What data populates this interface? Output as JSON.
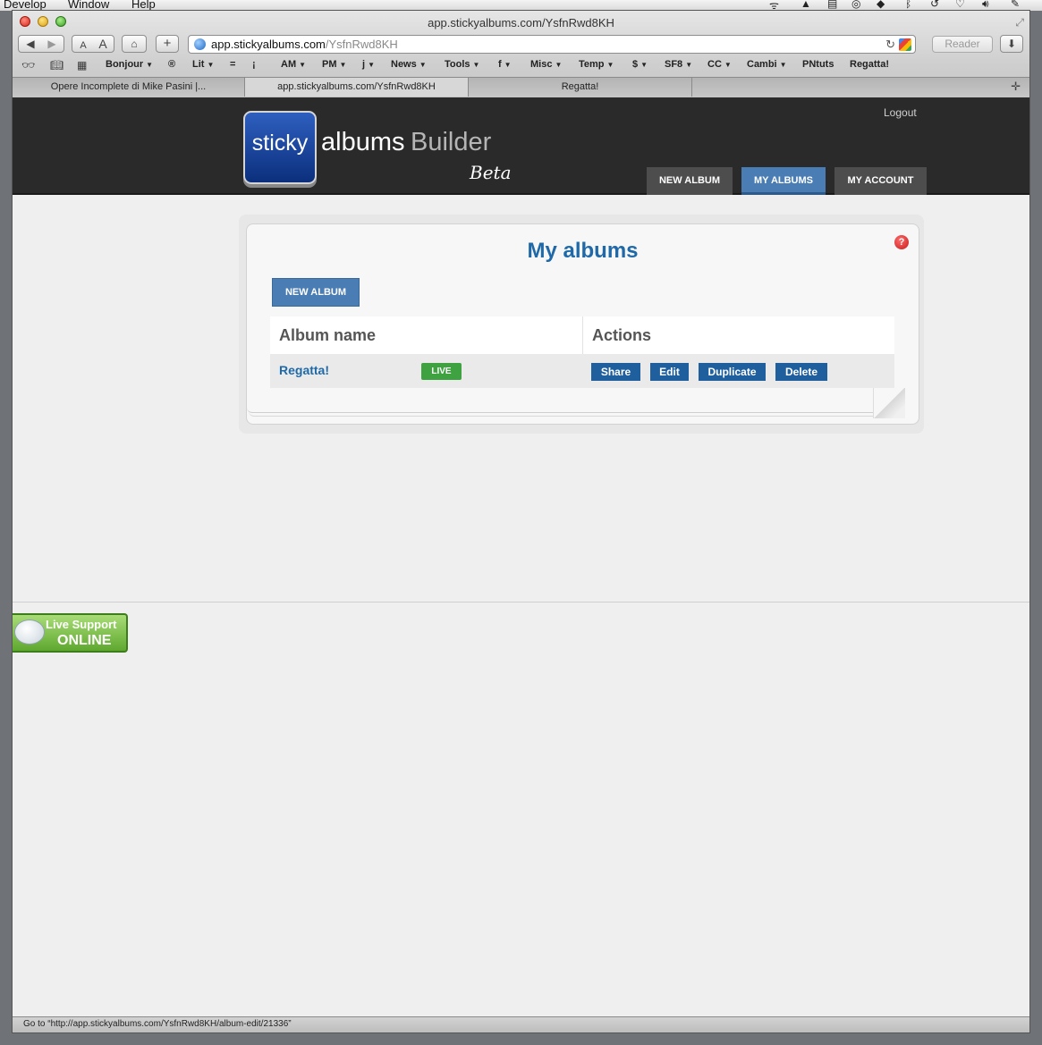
{
  "menubar": {
    "items": [
      "Develop",
      "Window",
      "Help"
    ]
  },
  "window": {
    "title": "app.stickyalbums.com/YsfnRwd8KH"
  },
  "toolbar": {
    "url_host": "app.stickyalbums.com",
    "url_path": "/YsfnRwd8KH",
    "reader_label": "Reader",
    "font_small": "A",
    "font_large": "A",
    "add_label": "+"
  },
  "bookmarks": [
    "Bonjour",
    "Lit",
    "AM",
    "PM",
    "j",
    "News",
    "Tools",
    "f",
    "Misc",
    "Temp",
    "$",
    "SF8",
    "CC",
    "Cambi",
    "PNtuts",
    "Regatta!"
  ],
  "tabs": [
    {
      "label": "Opere Incomplete di Mike Pasini |..."
    },
    {
      "label": "app.stickyalbums.com/YsfnRwd8KH"
    },
    {
      "label": "Regatta!"
    }
  ],
  "header": {
    "logo_sticky": "sticky",
    "logo_albums": "albums",
    "logo_builder": "Builder",
    "logo_beta": "Beta",
    "logout": "Logout",
    "nav": [
      {
        "label": "NEW ALBUM"
      },
      {
        "label": "MY ALBUMS"
      },
      {
        "label": "MY ACCOUNT"
      }
    ]
  },
  "main": {
    "title": "My albums",
    "new_album_label": "NEW ALBUM",
    "help": "?",
    "table": {
      "headers": [
        "Album name",
        "Actions"
      ],
      "rows": [
        {
          "name": "Regatta!",
          "badge": "LIVE",
          "actions": [
            "Share",
            "Edit",
            "Duplicate",
            "Delete"
          ]
        }
      ]
    }
  },
  "support": {
    "line1": "Live Support",
    "line2": "ONLINE"
  },
  "status": {
    "text": "Go to “http://app.stickyalbums.com/YsfnRwd8KH/album-edit/21336”"
  },
  "colors": {
    "accent": "#1f69a8",
    "nav_active": "#4a7db4",
    "live": "#3fa240",
    "header_bg": "#2a2a2a"
  }
}
